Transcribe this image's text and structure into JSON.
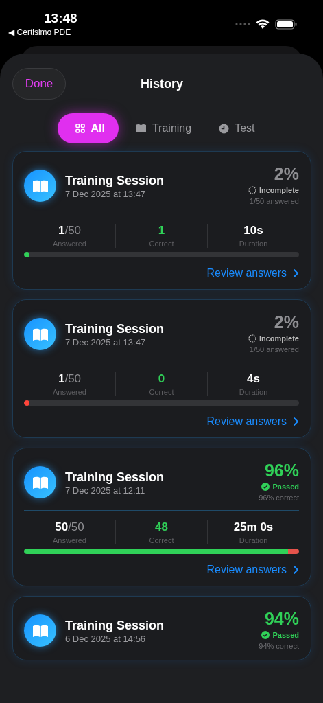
{
  "status_bar": {
    "time": "13:48",
    "back_label": "◀ Certisimo PDE"
  },
  "header": {
    "done_button": "Done",
    "title": "History"
  },
  "tabs": [
    {
      "label": "All",
      "selected": true
    },
    {
      "label": "Training",
      "selected": false
    },
    {
      "label": "Test",
      "selected": false
    }
  ],
  "sessions": [
    {
      "title": "Training Session",
      "date": "7 Dec 2025 at 13:47",
      "percent": "2%",
      "status": {
        "kind": "incomplete",
        "label": "Incomplete"
      },
      "summary": "1/50 answered",
      "stats": {
        "answered": "1",
        "total": "/50",
        "answered_label": "Answered",
        "correct": "1",
        "correct_label": "Correct",
        "duration": "10s",
        "duration_label": "Duration"
      },
      "progress": [
        {
          "level": 0.02,
          "color": "#30d158"
        }
      ],
      "link": "Review answers"
    },
    {
      "title": "Training Session",
      "date": "7 Dec 2025 at 13:47",
      "percent": "2%",
      "status": {
        "kind": "incomplete",
        "label": "Incomplete"
      },
      "summary": "1/50 answered",
      "stats": {
        "answered": "1",
        "total": "/50",
        "answered_label": "Answered",
        "correct": "0",
        "correct_label": "Correct",
        "duration": "4s",
        "duration_label": "Duration"
      },
      "progress": [
        {
          "level": 0.02,
          "color": "#ff453a"
        }
      ],
      "link": "Review answers"
    },
    {
      "title": "Training Session",
      "date": "7 Dec 2025 at 12:11",
      "percent": "96%",
      "status": {
        "kind": "passed",
        "label": "Passed"
      },
      "summary": "96% correct",
      "stats": {
        "answered": "50",
        "total": "/50",
        "answered_label": "Answered",
        "correct": "48",
        "correct_label": "Correct",
        "duration": "25m 0s",
        "duration_label": "Duration"
      },
      "progress": [
        {
          "level": 0.96,
          "color": "#30d158"
        },
        {
          "level": 0.04,
          "color": "#e5534b"
        }
      ],
      "link": "Review answers"
    },
    {
      "title": "Training Session",
      "date": "6 Dec 2025 at 14:56",
      "percent": "94%",
      "status": {
        "kind": "passed",
        "label": "Passed"
      },
      "summary": "94% correct"
    }
  ]
}
